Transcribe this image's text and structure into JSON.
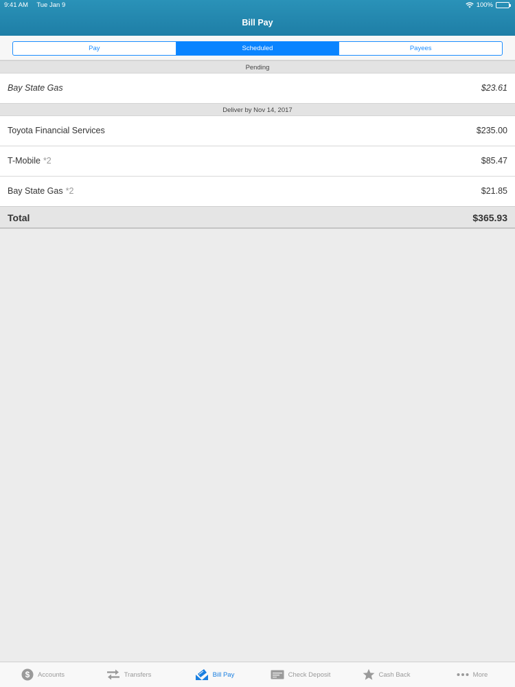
{
  "status_bar": {
    "time": "9:41 AM",
    "date": "Tue Jan 9",
    "battery": "100%"
  },
  "nav": {
    "title": "Bill Pay"
  },
  "segments": [
    {
      "label": "Pay",
      "active": false
    },
    {
      "label": "Scheduled",
      "active": true
    },
    {
      "label": "Payees",
      "active": false
    }
  ],
  "pending": {
    "header": "Pending",
    "items": [
      {
        "name": "Bay State Gas",
        "amount": "$23.61"
      }
    ]
  },
  "scheduled": {
    "header": "Deliver by Nov 14, 2017",
    "items": [
      {
        "name": "Toyota Financial Services",
        "count": "",
        "amount": "$235.00"
      },
      {
        "name": "T-Mobile",
        "count": "*2",
        "amount": "$85.47"
      },
      {
        "name": "Bay State Gas",
        "count": "*2",
        "amount": "$21.85"
      }
    ]
  },
  "total": {
    "label": "Total",
    "value": "$365.93"
  },
  "tabs": [
    {
      "label": "Accounts",
      "icon": "dollar-circle-icon",
      "active": false
    },
    {
      "label": "Transfers",
      "icon": "transfer-arrows-icon",
      "active": false
    },
    {
      "label": "Bill Pay",
      "icon": "bill-pay-icon",
      "active": true
    },
    {
      "label": "Check Deposit",
      "icon": "check-icon",
      "active": false
    },
    {
      "label": "Cash Back",
      "icon": "star-icon",
      "active": false
    },
    {
      "label": "More",
      "icon": "more-dots-icon",
      "active": false
    }
  ],
  "colors": {
    "header": "#1e7ea6",
    "accent": "#0a84ff",
    "tab_active": "#1a7fe0"
  }
}
